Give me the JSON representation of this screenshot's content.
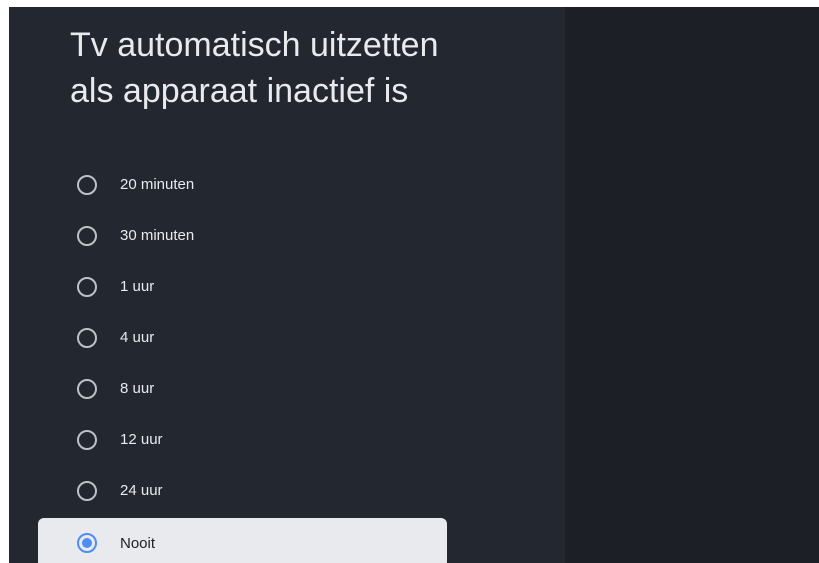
{
  "panel": {
    "title": "Tv automatisch uitzetten als apparaat inactief is"
  },
  "options": [
    {
      "label": "20 minuten",
      "selected": false
    },
    {
      "label": "30 minuten",
      "selected": false
    },
    {
      "label": "1 uur",
      "selected": false
    },
    {
      "label": "4 uur",
      "selected": false
    },
    {
      "label": "8 uur",
      "selected": false
    },
    {
      "label": "12 uur",
      "selected": false
    },
    {
      "label": "24 uur",
      "selected": false
    },
    {
      "label": "Nooit",
      "selected": true
    }
  ],
  "colors": {
    "panel_background": "#232730",
    "screen_background": "#1c1f26",
    "accent": "#4f8df5",
    "focus_background": "#e8eaed"
  }
}
